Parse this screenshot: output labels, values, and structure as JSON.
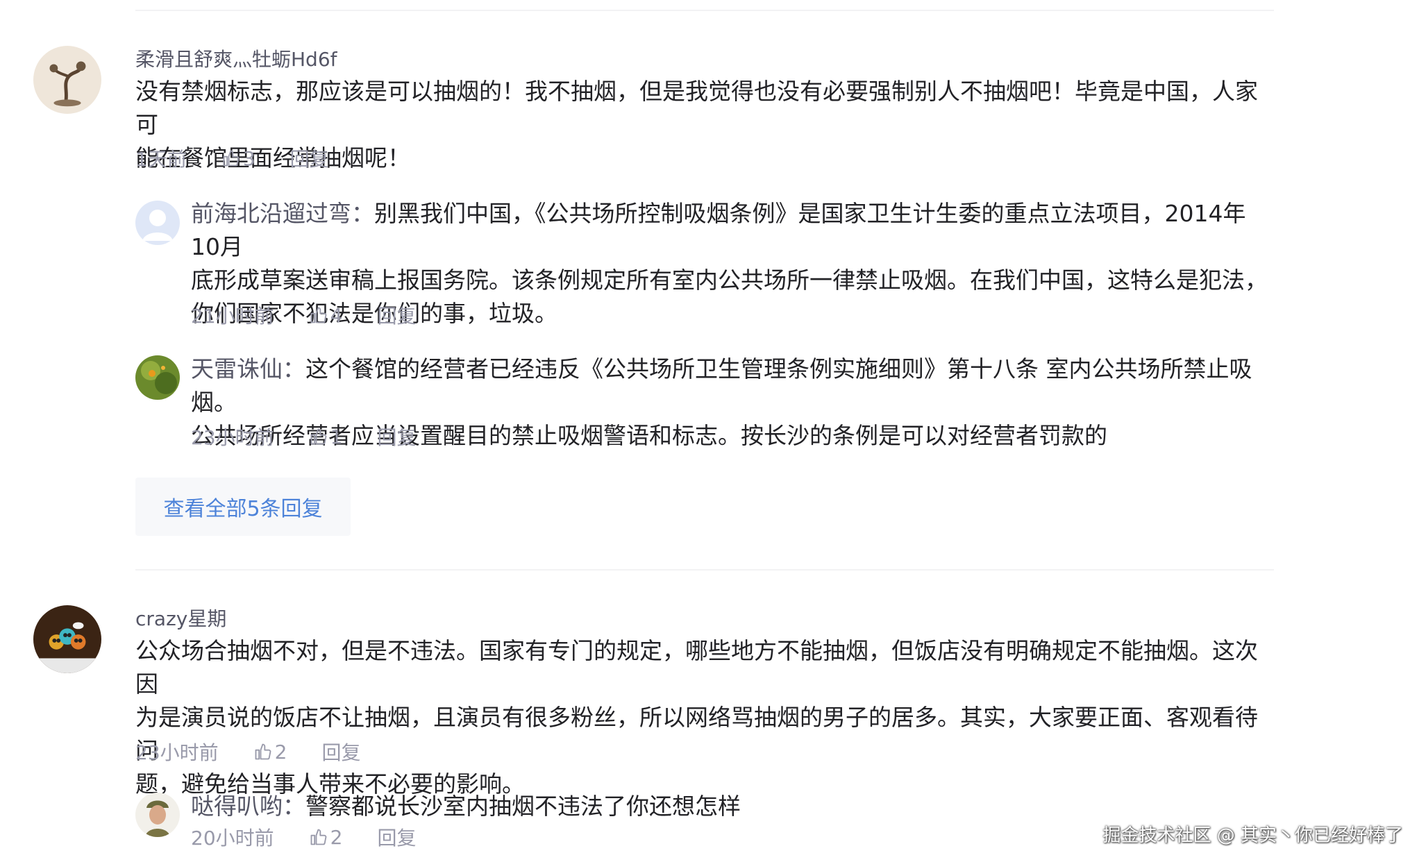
{
  "comments": [
    {
      "username": "柔滑且舒爽灬牡蛎Hd6f",
      "text_line1": "没有禁烟标志，那应该是可以抽烟的！我不抽烟，但是我觉得也没有必要强制别人不抽烟吧！毕竟是中国，人家可",
      "text_line2": "能在餐馆里面经常抽烟呢！",
      "time": "1天前",
      "likes": "3",
      "reply_label": "回复",
      "replies": [
        {
          "author": "前海北沿遛过弯：",
          "text_line1": "别黑我们中国，《公共场所控制吸烟条例》是国家卫生计生委的重点立法项目，2014年10月",
          "text_line2": "底形成草案送审稿上报国务院。该条例规定所有室内公共场所一律禁止吸烟。在我们中国，这特么是犯法，",
          "text_line3": "你们国家不犯法是你们的事，垃圾。",
          "time": "21小时前",
          "likes": "4",
          "reply_label": "回复"
        },
        {
          "author": "天雷诛仙：",
          "text_line1": "这个餐馆的经营者已经违反《公共场所卫生管理条例实施细则》第十八条 室内公共场所禁止吸烟。",
          "text_line2": "公共场所经营者应当设置醒目的禁止吸烟警语和标志。按长沙的条例是可以对经营者罚款的",
          "time": "23小时前",
          "likes": "1",
          "reply_label": "回复"
        }
      ],
      "view_all_label": "查看全部5条回复"
    },
    {
      "username": "crazy星期",
      "text_line1": "公众场合抽烟不对，但是不违法。国家有专门的规定，哪些地方不能抽烟，但饭店没有明确规定不能抽烟。这次因",
      "text_line2": "为是演员说的饭店不让抽烟，且演员有很多粉丝，所以网络骂抽烟的男子的居多。其实，大家要正面、客观看待问",
      "text_line3": "题，避免给当事人带来不必要的影响。",
      "time": "23小时前",
      "likes": "2",
      "reply_label": "回复",
      "replies": [
        {
          "author": "哒得叭哟：",
          "text_line1": "警察都说长沙室内抽烟不违法了你还想怎样",
          "time": "20小时前",
          "likes": "2",
          "reply_label": "回复"
        }
      ]
    }
  ],
  "watermark": "掘金技术社区 @ 其实丶你已经好棒了",
  "colors": {
    "username": "#555666",
    "meta": "#999aaa",
    "link": "#4d83d9",
    "text": "#222226"
  },
  "icons": [
    "thumbs-up-icon",
    "avatar-image"
  ]
}
